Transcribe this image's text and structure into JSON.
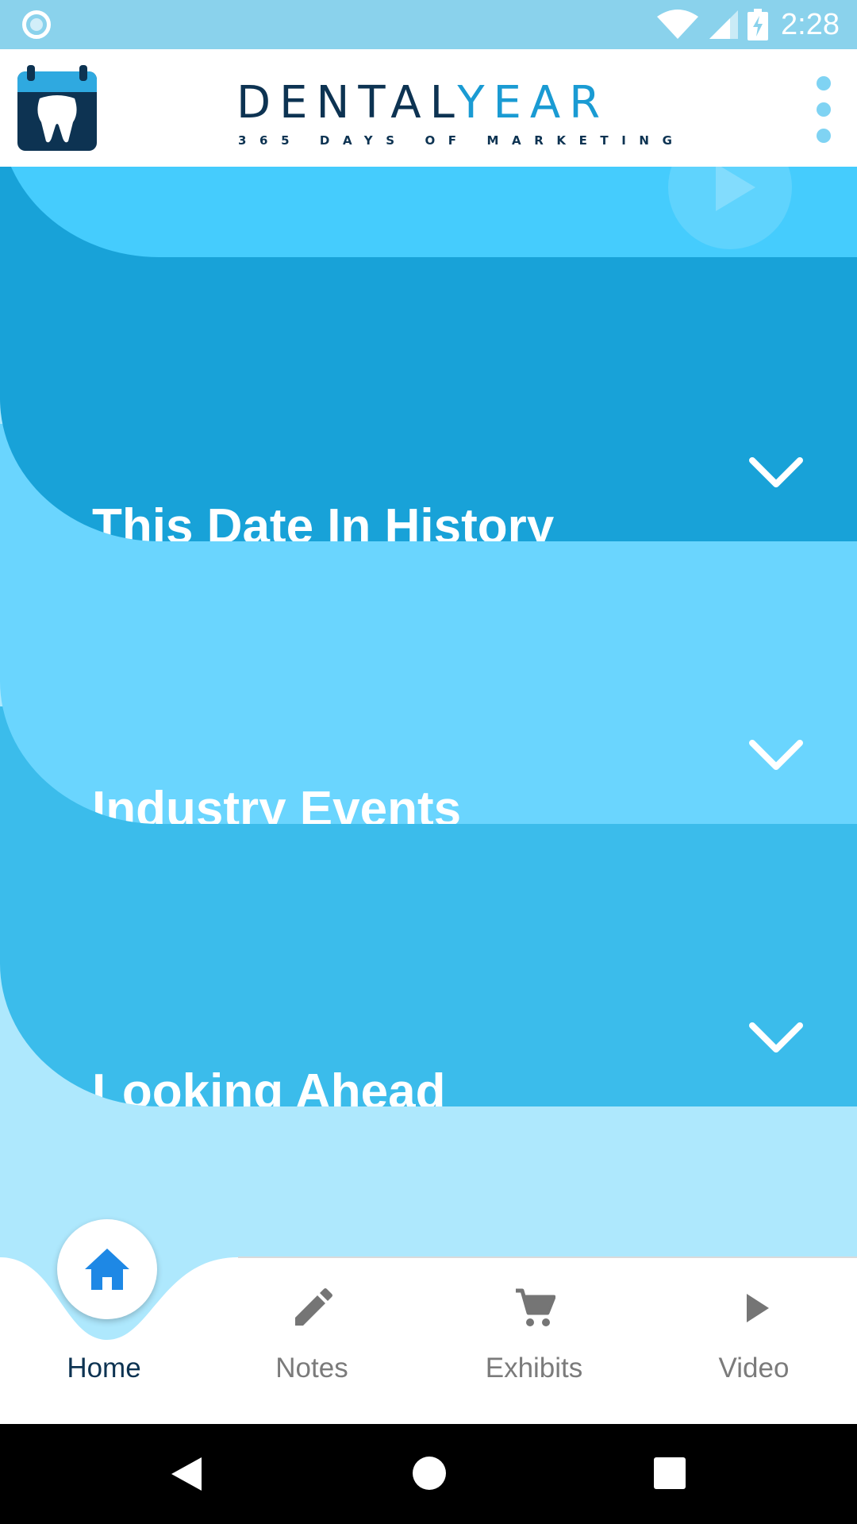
{
  "status_bar": {
    "time": "2:28",
    "icons": [
      "sync-circle-icon",
      "wifi-icon",
      "signal-icon",
      "battery-charging-icon"
    ]
  },
  "header": {
    "brand_dental": "DENTAL",
    "brand_year": "YEAR",
    "brand_tagline": "365 DAYS OF MARKETING",
    "logo_icon": "calendar-tooth-icon",
    "menu_icon": "more-vertical-icon"
  },
  "cards": [
    {
      "title": "",
      "icon": "play-icon",
      "color": "#45ccfd"
    },
    {
      "title": "This Date In History",
      "icon": "history-list-icon",
      "color": "#18a2d8"
    },
    {
      "title": "Industry Events",
      "icon": "event-checklist-clock-icon",
      "color": "#6ad5fe"
    },
    {
      "title": "Looking Ahead",
      "icon": "arrow-up-icon",
      "color": "#3bbceb"
    }
  ],
  "bottom_nav": {
    "items": [
      {
        "label": "Home",
        "icon": "home-icon",
        "active": true
      },
      {
        "label": "Notes",
        "icon": "pencil-icon",
        "active": false
      },
      {
        "label": "Exhibits",
        "icon": "cart-icon",
        "active": false
      },
      {
        "label": "Video",
        "icon": "play-icon",
        "active": false
      }
    ]
  },
  "colors": {
    "status_bar": "#8ad2ec",
    "brand_navy": "#0d3352",
    "brand_blue": "#1a9bd3",
    "page_background": "#aee8fd",
    "active_nav": "#1e88e5",
    "inactive_nav": "#7b7b7b"
  },
  "system_nav": {
    "icons": [
      "back-icon",
      "home-circle-icon",
      "recents-icon"
    ]
  }
}
